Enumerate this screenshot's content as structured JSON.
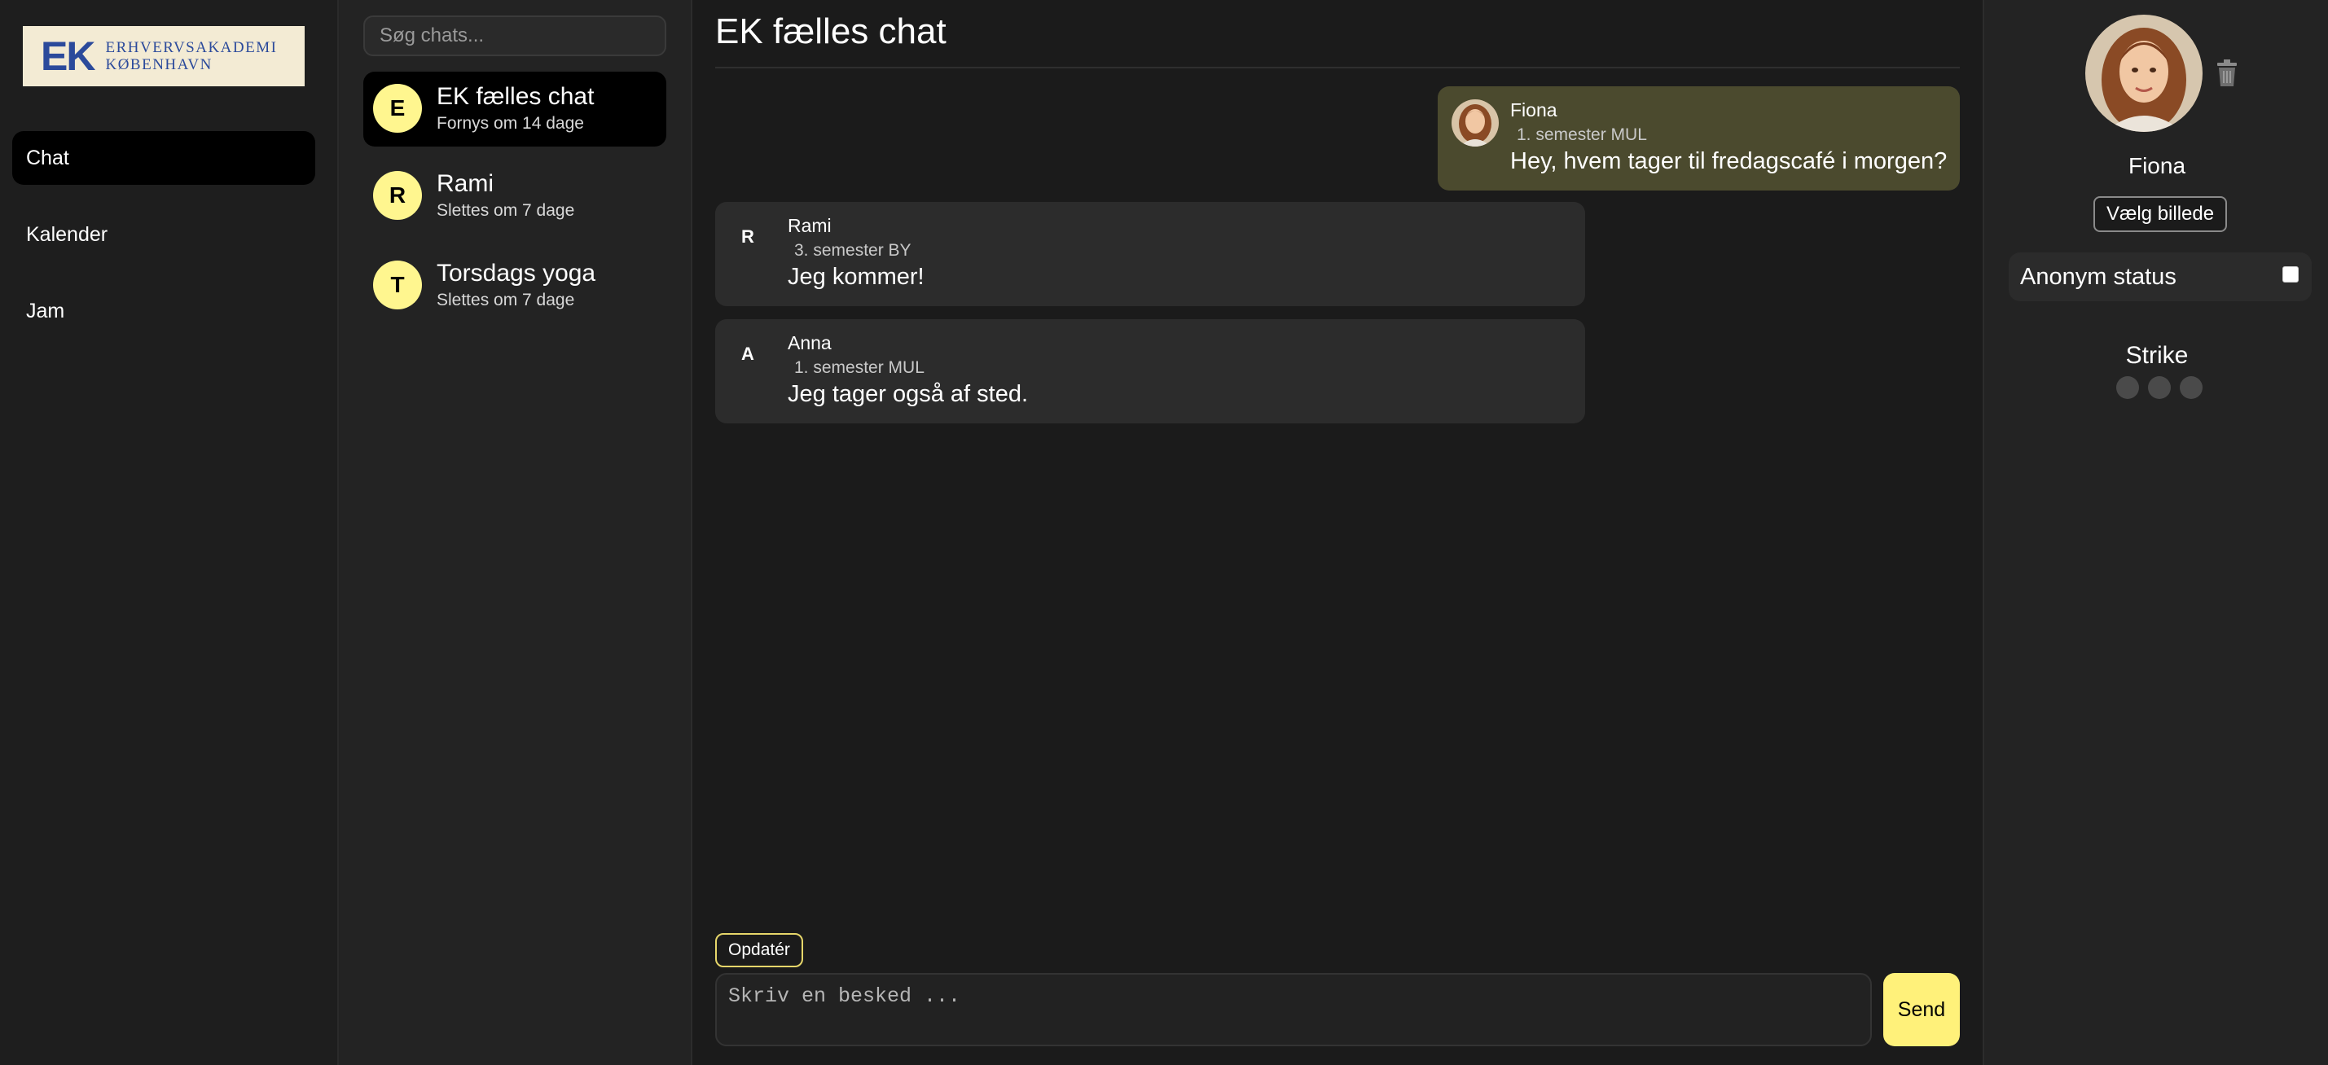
{
  "nav": {
    "logo": {
      "mark": "EK",
      "line1": "ERHVERVSAKADEMI",
      "line2": "KØBENHAVN"
    },
    "items": [
      {
        "label": "Chat",
        "active": true
      },
      {
        "label": "Kalender",
        "active": false
      },
      {
        "label": "Jam",
        "active": false
      }
    ]
  },
  "chatlist": {
    "search_placeholder": "Søg chats...",
    "items": [
      {
        "initial": "E",
        "name": "EK fælles chat",
        "sub": "Fornys om 14 dage",
        "active": true
      },
      {
        "initial": "R",
        "name": "Rami",
        "sub": "Slettes om 7 dage",
        "active": false
      },
      {
        "initial": "T",
        "name": "Torsdags yoga",
        "sub": "Slettes om 7 dage",
        "active": false
      }
    ]
  },
  "main": {
    "title": "EK fælles chat",
    "messages": [
      {
        "own": true,
        "author": "Fiona",
        "role": "1. semester MUL",
        "text": "Hey, hvem tager til fredagscafé i morgen?"
      },
      {
        "own": false,
        "initial": "R",
        "author": "Rami",
        "role": "3. semester BY",
        "text": "Jeg kommer!"
      },
      {
        "own": false,
        "initial": "A",
        "author": "Anna",
        "role": "1. semester MUL",
        "text": "Jeg tager også af sted."
      }
    ],
    "update_label": "Opdatér",
    "compose_placeholder": "Skriv en besked ...",
    "send_label": "Send"
  },
  "profile": {
    "name": "Fiona",
    "choose_label": "Vælg billede",
    "anon_label": "Anonym status",
    "anon_checked": false,
    "strike_label": "Strike",
    "strikes": 3,
    "strike_count": 0
  },
  "colors": {
    "accent": "#fff17a",
    "avatar_bg": "#fff68f",
    "own_message_bg": "#4b4a2e",
    "other_message_bg": "#2c2c2c",
    "background": "#1b1b1b"
  },
  "icons": {
    "trash": "trash-icon"
  }
}
